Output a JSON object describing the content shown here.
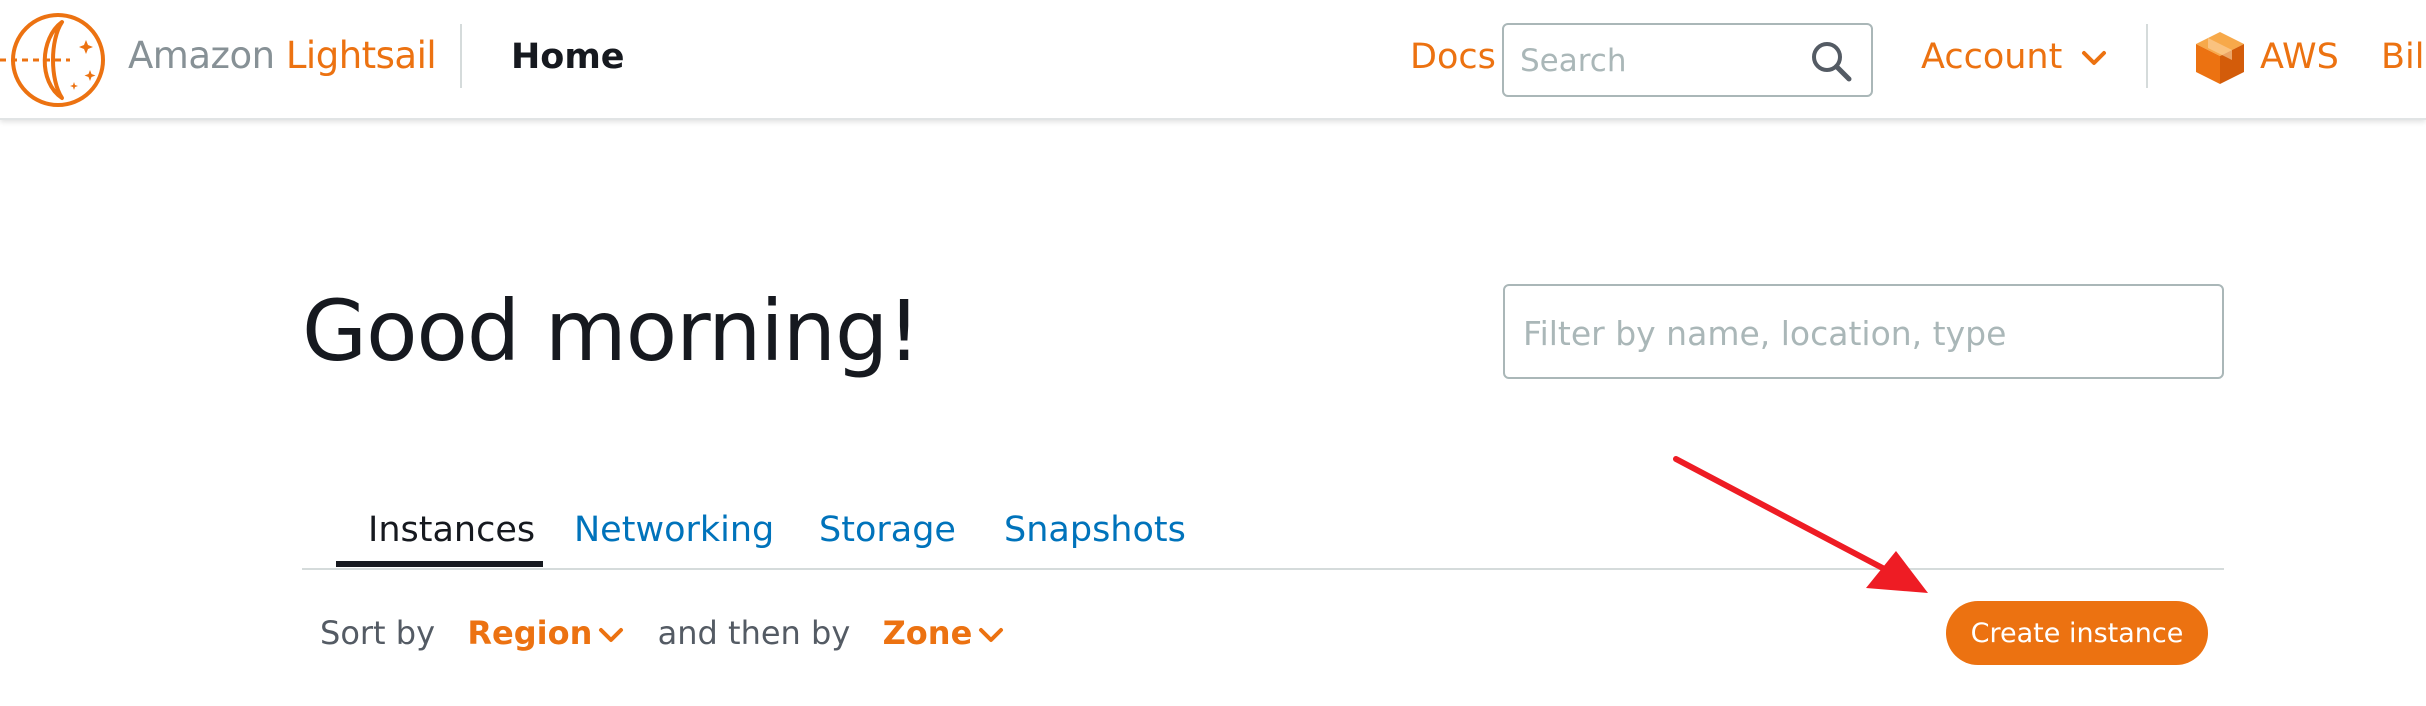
{
  "header": {
    "brand_prefix": "Amazon",
    "brand_name": "Lightsail",
    "home": "Home",
    "docs": "Docs",
    "search_placeholder": "Search",
    "account": "Account",
    "aws": "AWS",
    "billing_truncated": "Bill"
  },
  "main": {
    "greeting": "Good morning!",
    "filter_placeholder": "Filter by name, location, type",
    "tabs": [
      {
        "label": "Instances",
        "active": true
      },
      {
        "label": "Networking",
        "active": false
      },
      {
        "label": "Storage",
        "active": false
      },
      {
        "label": "Snapshots",
        "active": false
      }
    ],
    "sort": {
      "prefix": "Sort by",
      "primary": "Region",
      "middle": "and then by",
      "secondary": "Zone"
    },
    "create_button": "Create instance"
  },
  "colors": {
    "accent": "#ec7211",
    "link": "#0073bb",
    "text": "#16191f",
    "muted": "#879196",
    "annotation_arrow": "#ee1c24"
  },
  "icons": {
    "logo": "lightsail-logo-icon",
    "search": "search-icon",
    "account_chevron": "chevron-down-icon",
    "aws": "aws-cube-icon",
    "sort_chevron": "chevron-down-icon",
    "annotation": "red-arrow-icon"
  }
}
